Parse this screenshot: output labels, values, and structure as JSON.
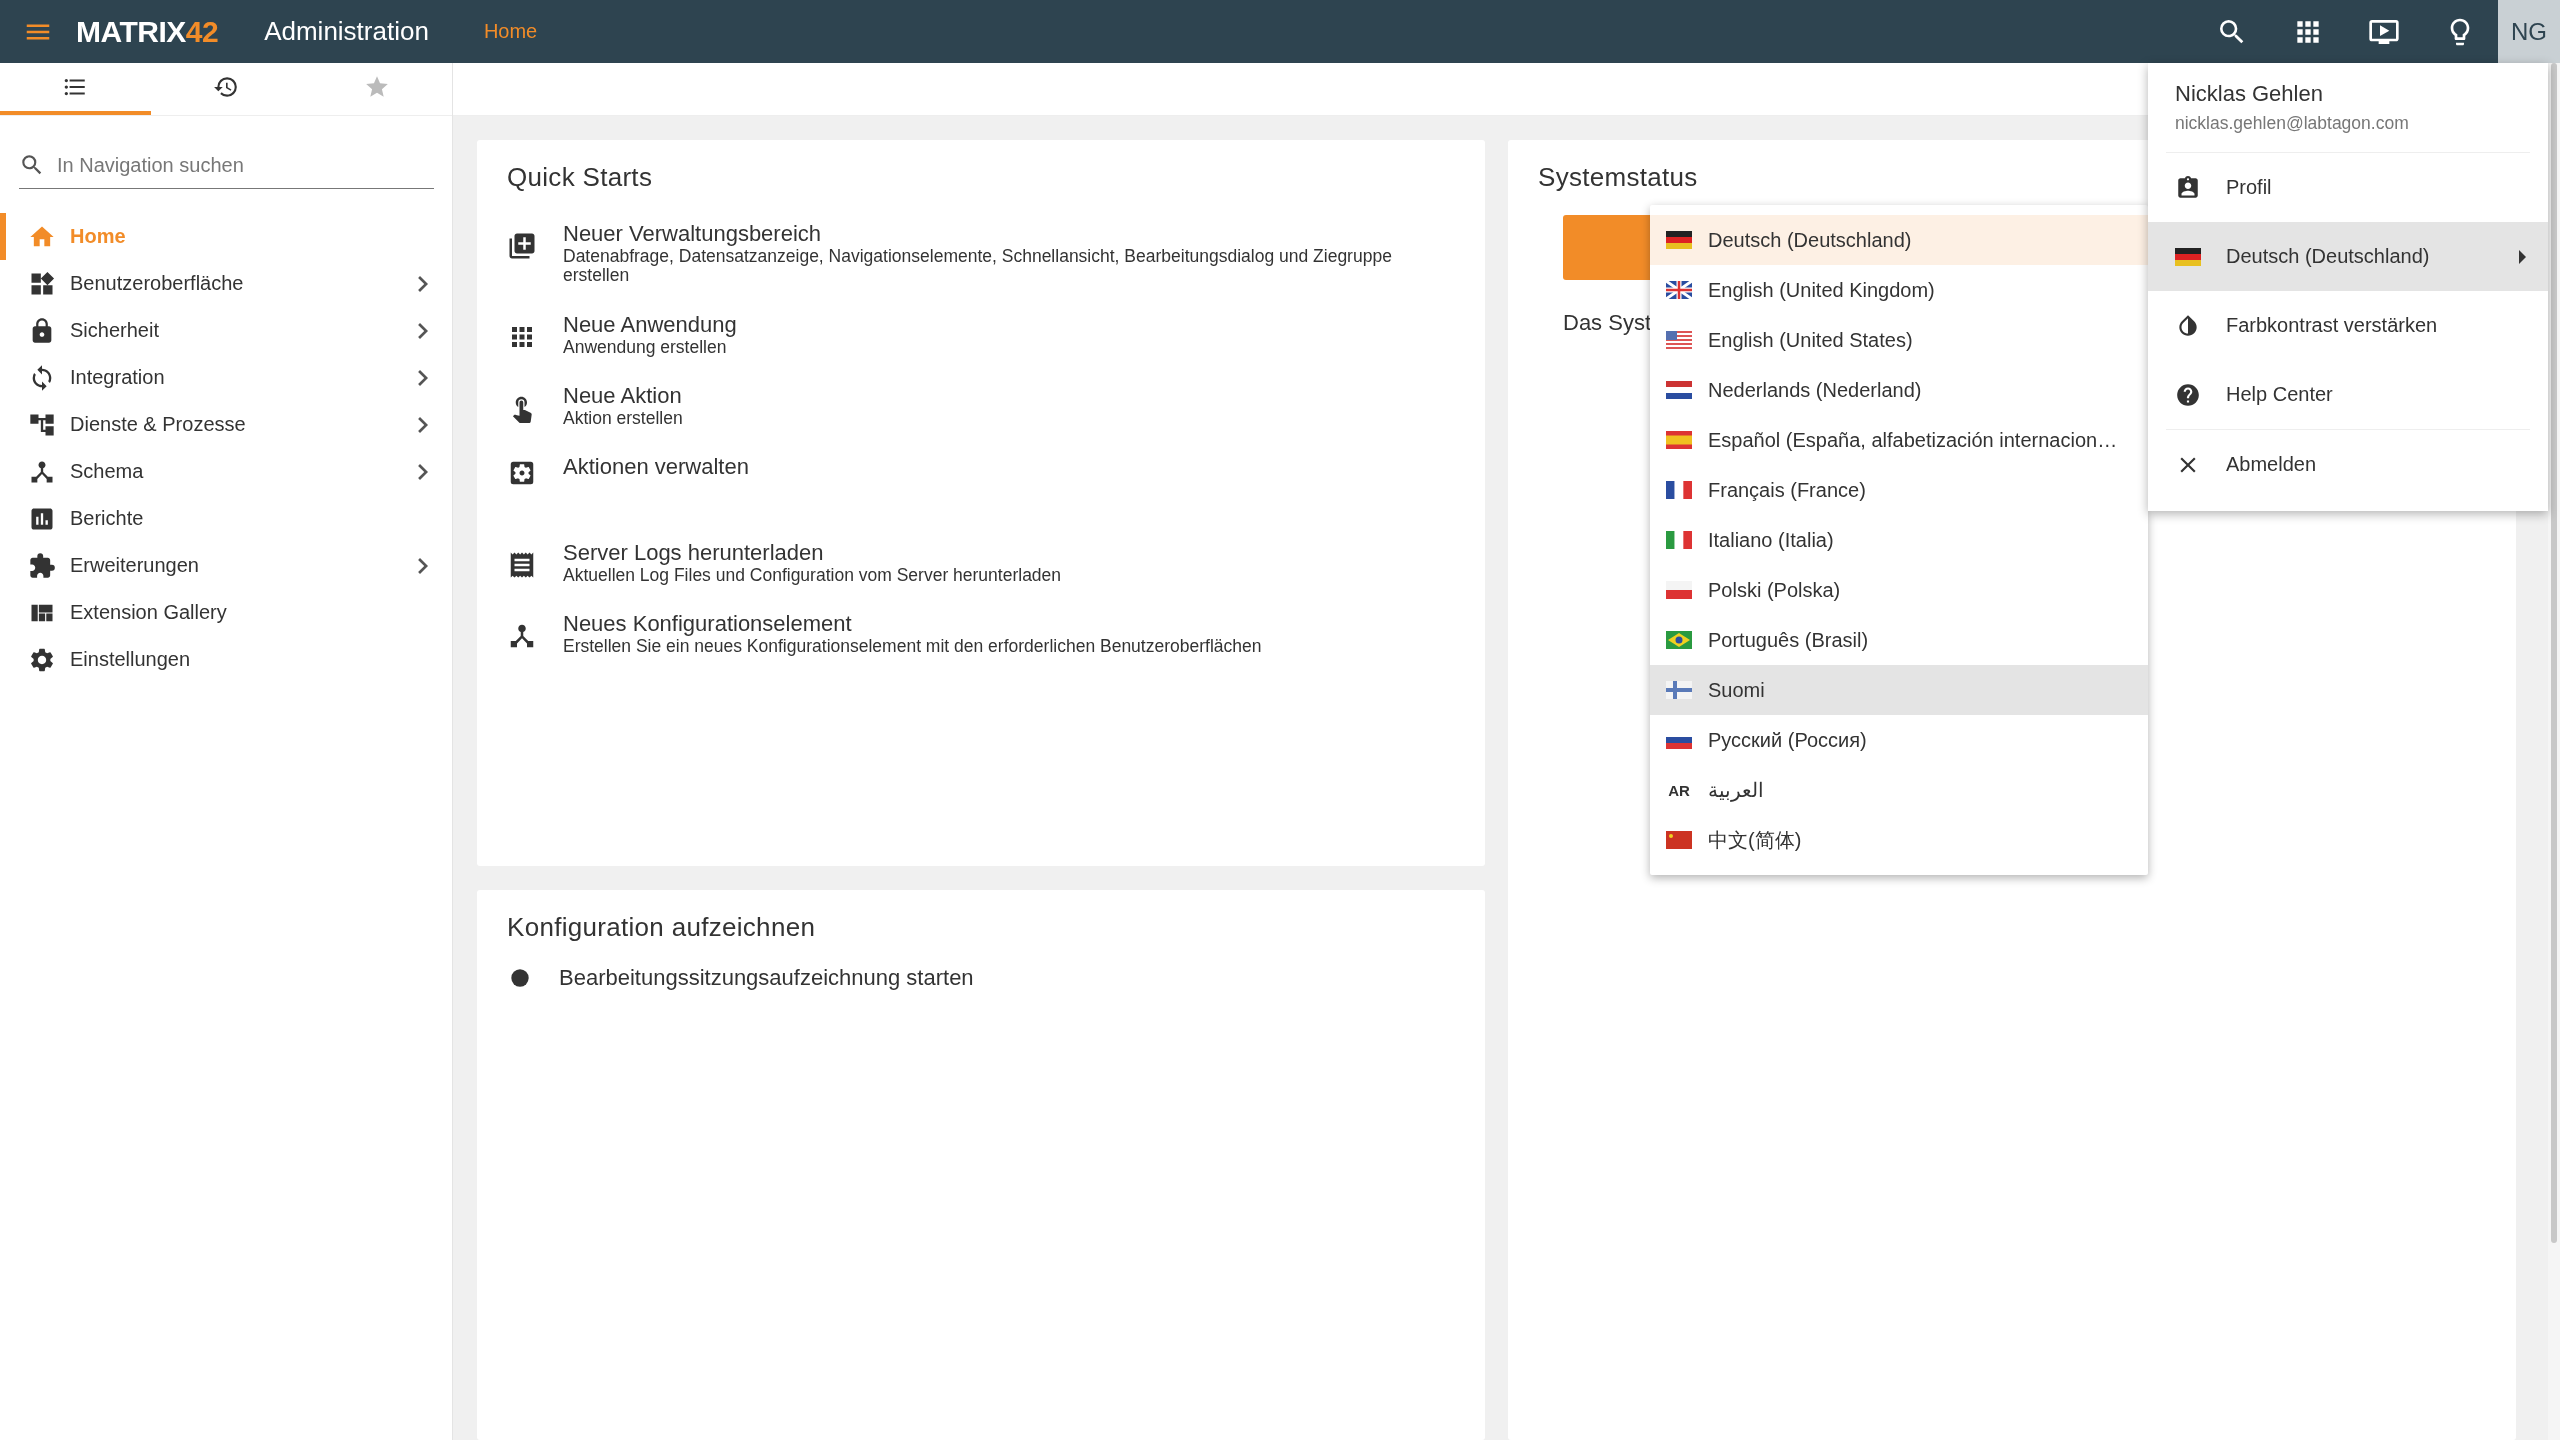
{
  "topbar": {
    "logo": {
      "text": "MATRIX",
      "accent": "42"
    },
    "title": "Administration",
    "breadcrumb": "Home",
    "avatar": "NG"
  },
  "sidebar": {
    "tabs": [
      {
        "kind": "list",
        "selected": true
      },
      {
        "kind": "history",
        "selected": false
      },
      {
        "kind": "favorites",
        "selected": false
      }
    ],
    "search": {
      "placeholder": "In Navigation suchen"
    },
    "items": [
      {
        "label": "Home",
        "selected": true,
        "submenu": false
      },
      {
        "label": "Benutzeroberfläche",
        "selected": false,
        "submenu": true
      },
      {
        "label": "Sicherheit",
        "selected": false,
        "submenu": true
      },
      {
        "label": "Integration",
        "selected": false,
        "submenu": true
      },
      {
        "label": "Dienste & Prozesse",
        "selected": false,
        "submenu": true
      },
      {
        "label": "Schema",
        "selected": false,
        "submenu": true
      },
      {
        "label": "Berichte",
        "selected": false,
        "submenu": false
      },
      {
        "label": "Erweiterungen",
        "selected": false,
        "submenu": true
      },
      {
        "label": "Extension Gallery",
        "selected": false,
        "submenu": false
      },
      {
        "label": "Einstellungen",
        "selected": false,
        "submenu": false
      }
    ]
  },
  "quick_starts": {
    "title": "Quick Starts",
    "items": [
      {
        "title": "Neuer Verwaltungsbereich",
        "subtitle": "Datenabfrage, Datensatzanzeige, Navigationselemente, Schnellansicht, Bearbeitungsdialog und Ziegruppe erstellen"
      },
      {
        "title": "Neue Anwendung",
        "subtitle": "Anwendung erstellen"
      },
      {
        "title": "Neue Aktion",
        "subtitle": "Aktion erstellen"
      },
      {
        "title": "Aktionen verwalten"
      },
      {
        "title": "Server Logs herunterladen",
        "subtitle": "Aktuellen Log Files und Configuration vom Server herunterladen"
      },
      {
        "title": "Neues Konfigurationselement",
        "subtitle": "Erstellen Sie ein neues Konfigurationselement mit den erforderlichen Benutzeroberflächen"
      }
    ]
  },
  "record_config": {
    "title": "Konfiguration aufzeichnen",
    "action": "Bearbeitungssitzungsaufzeichnung starten"
  },
  "system_status": {
    "title": "Systemstatus",
    "text": "Das Syst"
  },
  "language_menu": {
    "items": [
      {
        "label": "Deutsch (Deutschland)",
        "kind": "flag",
        "selected": true,
        "highlighted": false
      },
      {
        "label": "English (United Kingdom)",
        "kind": "flag",
        "selected": false,
        "highlighted": false
      },
      {
        "label": "English (United States)",
        "kind": "flag",
        "selected": false,
        "highlighted": false
      },
      {
        "label": "Nederlands (Nederland)",
        "kind": "flag",
        "selected": false,
        "highlighted": false
      },
      {
        "label": "Español (España, alfabetización internacion…",
        "kind": "flag",
        "selected": false,
        "highlighted": false
      },
      {
        "label": "Français (France)",
        "kind": "flag",
        "selected": false,
        "highlighted": false
      },
      {
        "label": "Italiano (Italia)",
        "kind": "flag",
        "selected": false,
        "highlighted": false
      },
      {
        "label": "Polski (Polska)",
        "kind": "flag",
        "selected": false,
        "highlighted": false
      },
      {
        "label": "Português (Brasil)",
        "kind": "flag",
        "selected": false,
        "highlighted": false
      },
      {
        "label": "Suomi",
        "kind": "flag",
        "selected": false,
        "highlighted": true
      },
      {
        "label": "Русский (Россия)",
        "kind": "flag",
        "selected": false,
        "highlighted": false
      },
      {
        "label": "العربية",
        "kind": "code",
        "code": "AR",
        "selected": false,
        "highlighted": false
      },
      {
        "label": "中文(简体)",
        "kind": "flag",
        "selected": false,
        "highlighted": false
      }
    ]
  },
  "user_menu": {
    "name": "Nicklas Gehlen",
    "email": "nicklas.gehlen@labtagon.com",
    "items": [
      {
        "label": "Profil",
        "kind": "profile",
        "expanded": false
      },
      {
        "label": "Deutsch (Deutschland)",
        "kind": "language",
        "expanded": true
      },
      {
        "label": "Farbkontrast verstärken",
        "kind": "contrast",
        "expanded": false
      },
      {
        "label": "Help Center",
        "kind": "help",
        "expanded": false
      },
      {
        "label": "Abmelden",
        "kind": "logout",
        "expanded": false
      }
    ]
  }
}
